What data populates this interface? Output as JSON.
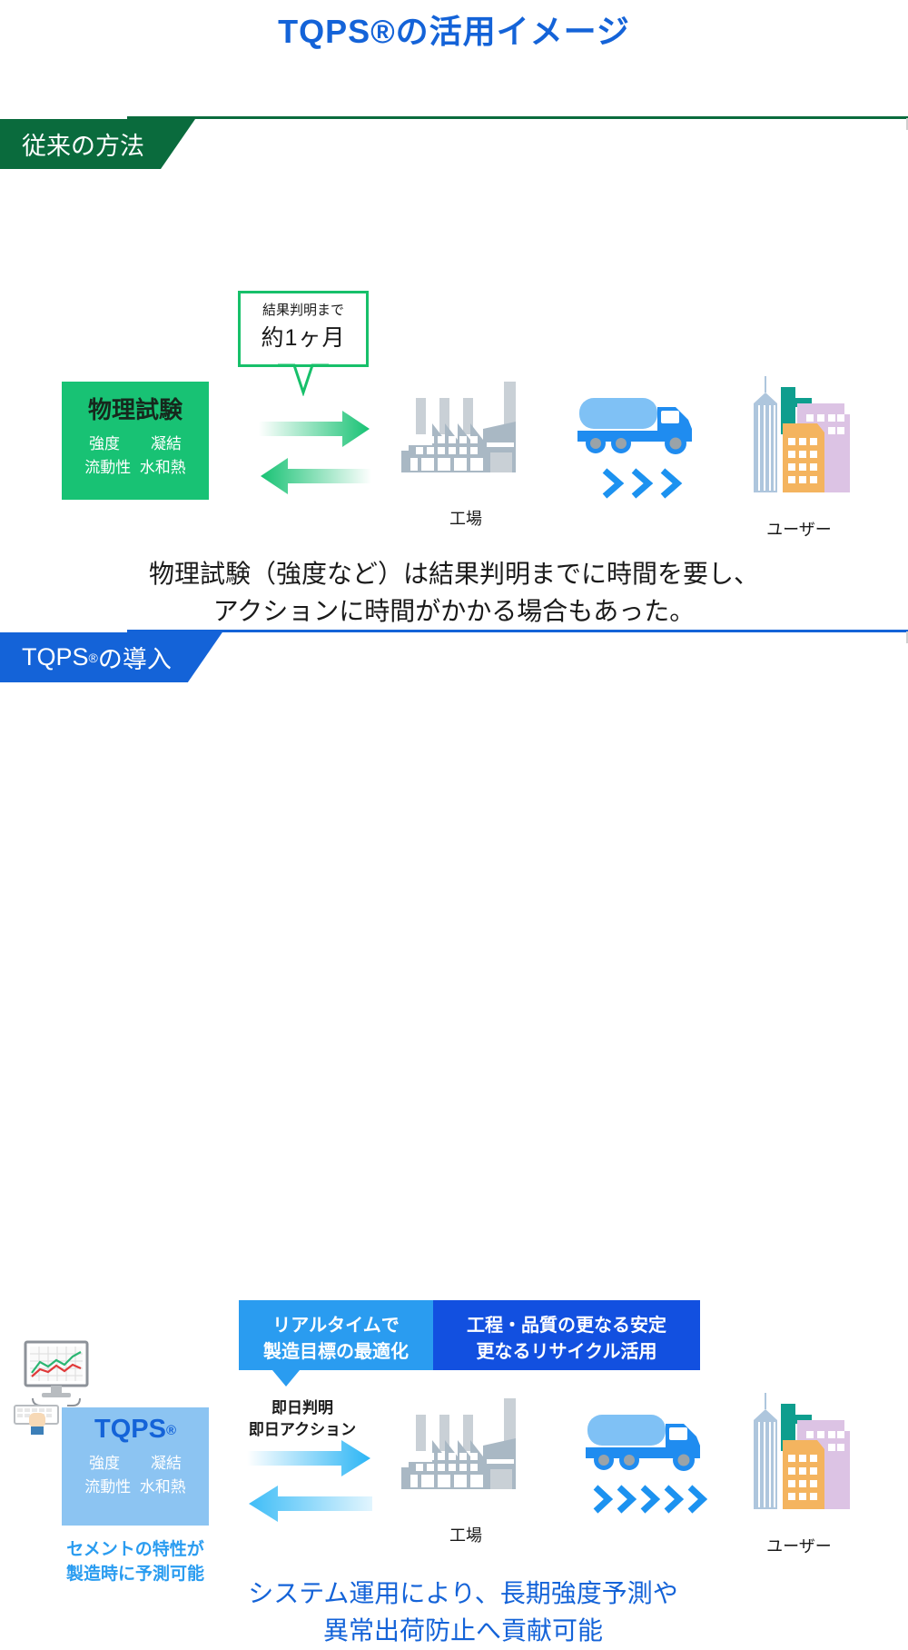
{
  "title": "TQPS®の活用イメージ",
  "colors": {
    "title_blue": "#1463d8",
    "green_dark": "#0a6b3d",
    "green_bright": "#18c274",
    "green_callout": "#17c06a",
    "blue_banner": "#1463d8",
    "blue_light_box": "#8cc4f2",
    "blue_benefit_left": "#2a9cf0",
    "blue_benefit_right": "#1250e0",
    "chevron_blue": "#1c92f0",
    "factory_gray": "#a9b8c4",
    "truck_blue": "#1f8cf0",
    "truck_tank": "#7fc1f5",
    "building_orange": "#f4b45f",
    "building_purple": "#dcc3e4",
    "building_blue": "#aec6dd",
    "building_teal": "#0e9e8e"
  },
  "sections": [
    {
      "id": "conventional",
      "banner_label": "従来の方法",
      "banner_reg": "",
      "callout": {
        "small_text": "結果判明まで",
        "big_text": "約1ヶ月"
      },
      "test_box": {
        "heading": "物理試験",
        "heading_reg": "",
        "properties": "強度　　凝結\n流動性  水和熱"
      },
      "icons": {
        "factory_label": "工場",
        "truck_label": "",
        "buildings_label": "ユーザー",
        "chevron_count": 3
      },
      "note": "物理試験（強度など）は結果判明までに時間を要し、\nアクションに時間がかかる場合もあった。"
    },
    {
      "id": "tqps",
      "banner_label": "TQPS",
      "banner_reg": "®",
      "banner_suffix": "の導入",
      "benefits": [
        {
          "id": "benefit-left",
          "text": "リアルタイムで\n製造目標の最適化"
        },
        {
          "id": "benefit-right",
          "text": "工程・品質の更なる安定\n更なるリサイクル活用"
        }
      ],
      "immediate_labels": "即日判明\n即日アクション",
      "test_box": {
        "heading": "TQPS",
        "heading_reg": "®",
        "properties": "強度　　凝結\n流動性  水和熱"
      },
      "predict_note": "セメントの特性が\n製造時に予測可能",
      "icons": {
        "factory_label": "工場",
        "truck_label": "",
        "buildings_label": "ユーザー",
        "chevron_count": 5
      },
      "note": "システム運用により、長期強度予測や\n異常出荷防止へ貢献可能"
    }
  ]
}
